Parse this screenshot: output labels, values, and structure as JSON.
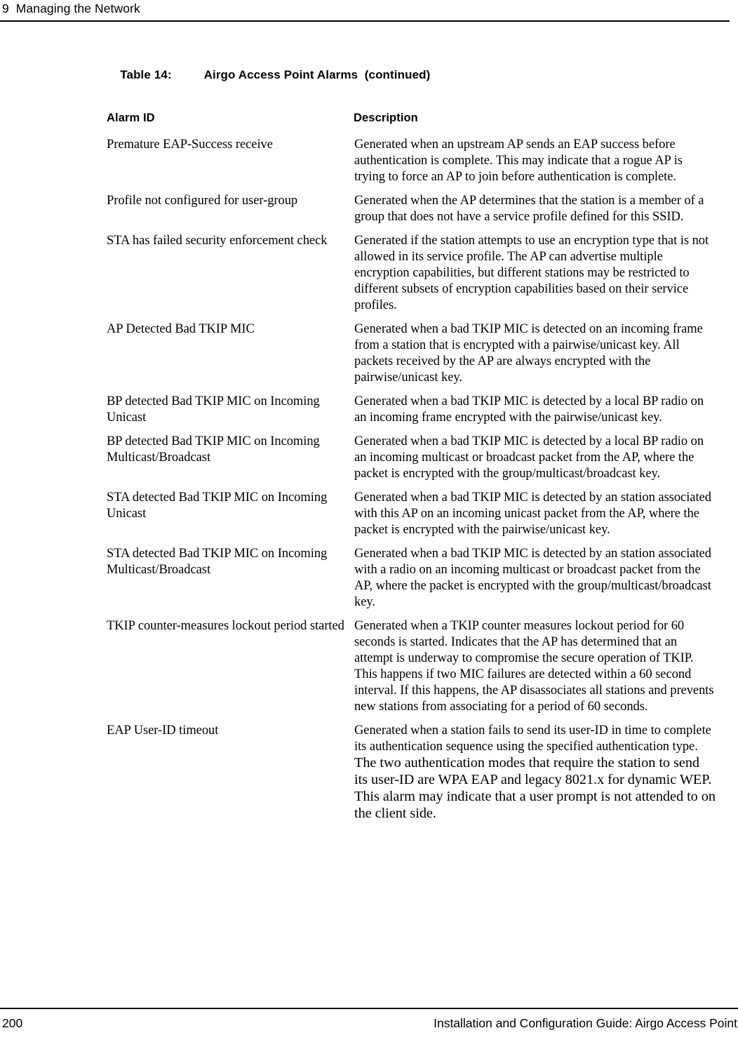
{
  "header": {
    "chapter_number": "9",
    "chapter_title": "Managing the Network",
    "running_head": "9  Managing the Network"
  },
  "table": {
    "caption_label": "Table 14:",
    "caption_title": "Airgo Access Point Alarms  (continued)",
    "columns": {
      "alarm_id": "Alarm ID",
      "description": "Description"
    },
    "rows": [
      {
        "alarm_id": "Premature EAP-Success receive",
        "description": "Generated when an upstream AP sends an EAP success before authentication is complete. This may indicate that a rogue AP is trying to force an AP to join before authentication is complete."
      },
      {
        "alarm_id": "Profile not configured for user-group",
        "description": "Generated when the AP determines that the station is a member of a group that does not have a service profile defined for this SSID."
      },
      {
        "alarm_id": "STA has failed security enforcement check",
        "description": "Generated if the station attempts to use an encryption type that is not allowed in its service profile. The AP can advertise multiple encryption capabilities, but different stations may be restricted to different subsets of encryption capabilities based on their service profiles."
      },
      {
        "alarm_id": "AP Detected Bad TKIP MIC",
        "description": "Generated when a bad TKIP MIC is detected on an incoming frame from a station that is encrypted with a pairwise/unicast key. All packets received by the AP are always encrypted with the pairwise/unicast key."
      },
      {
        "alarm_id": "BP detected Bad TKIP MIC on Incoming Unicast",
        "description": "Generated when a bad TKIP MIC is detected by a local BP radio on an incoming frame encrypted with the pairwise/unicast key."
      },
      {
        "alarm_id": "BP detected Bad TKIP MIC on Incoming Multicast/Broadcast",
        "description": "Generated when a bad TKIP MIC is detected by a local BP radio on an incoming multicast or broadcast packet from the AP, where the packet is encrypted with the group/multicast/broadcast key."
      },
      {
        "alarm_id": "STA detected Bad TKIP MIC on Incoming Unicast",
        "description": "Generated when a bad TKIP MIC is detected by an station associated with this AP on an incoming unicast packet from the AP, where the packet is encrypted with the pairwise/unicast key."
      },
      {
        "alarm_id": "STA detected Bad TKIP MIC on Incoming Multicast/Broadcast",
        "description": "Generated when a bad TKIP MIC is detected by an station associated with a radio on an incoming multicast or broadcast packet from the AP, where the packet is encrypted with the group/multicast/broadcast key."
      },
      {
        "alarm_id": "TKIP counter-measures lockout period started",
        "description": "Generated when a TKIP counter measures lockout period for 60 seconds is started. Indicates that the AP has determined that an attempt is underway to compromise the secure operation of TKIP. This happens if two MIC failures are detected within a 60 second interval. If this happens, the AP disassociates all stations and prevents new stations from associating for a period of 60 seconds."
      },
      {
        "alarm_id": "EAP User-ID timeout",
        "description_part1": "Generated when a station fails to send its user-ID in time to complete its authentication sequence using the specified authentication type. ",
        "description_part2": "The two authentication modes that require the station to send its user-ID are WPA EAP and legacy 8021.x for dynamic WEP. This alarm may indicate that a user prompt is not attended to on the client side."
      }
    ]
  },
  "footer": {
    "page_number": "200",
    "document_title": "Installation and Configuration Guide: Airgo Access Point"
  }
}
